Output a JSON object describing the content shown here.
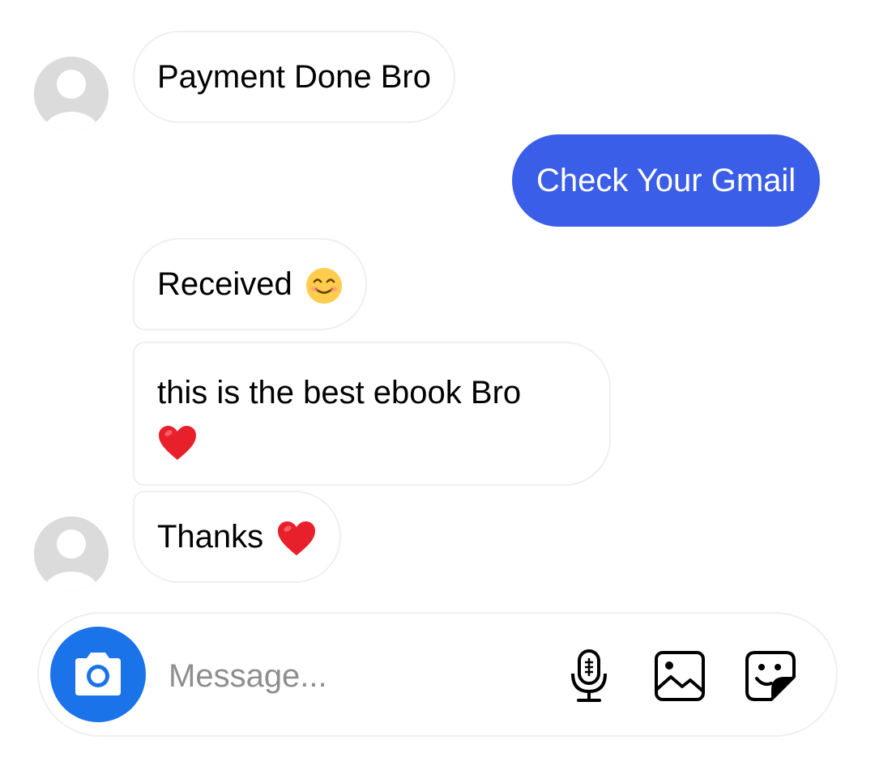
{
  "messages": [
    {
      "direction": "received",
      "text": "Payment Done Bro",
      "emoji": "",
      "show_avatar": true
    },
    {
      "direction": "sent",
      "text": "Check Your Gmail",
      "emoji": ""
    },
    {
      "direction": "received",
      "text": "Received",
      "emoji": "smiling-face-icon",
      "show_avatar": false
    },
    {
      "direction": "received",
      "text": "this is the best ebook Bro",
      "emoji": "red-heart-icon",
      "show_avatar": false
    },
    {
      "direction": "received",
      "text": "Thanks",
      "emoji": "red-heart-icon",
      "show_avatar": true
    }
  ],
  "composer": {
    "placeholder": "Message...",
    "value": "",
    "icons": [
      "camera-icon",
      "microphone-icon",
      "gallery-icon",
      "sticker-icon"
    ]
  },
  "colors": {
    "sent_bubble": "#3b5ee8",
    "camera_button": "#1a73e8",
    "received_border": "#efefef",
    "avatar": "#dbdbdb",
    "heart": "#e8202c",
    "emoji_face": "#ffcc4d"
  }
}
